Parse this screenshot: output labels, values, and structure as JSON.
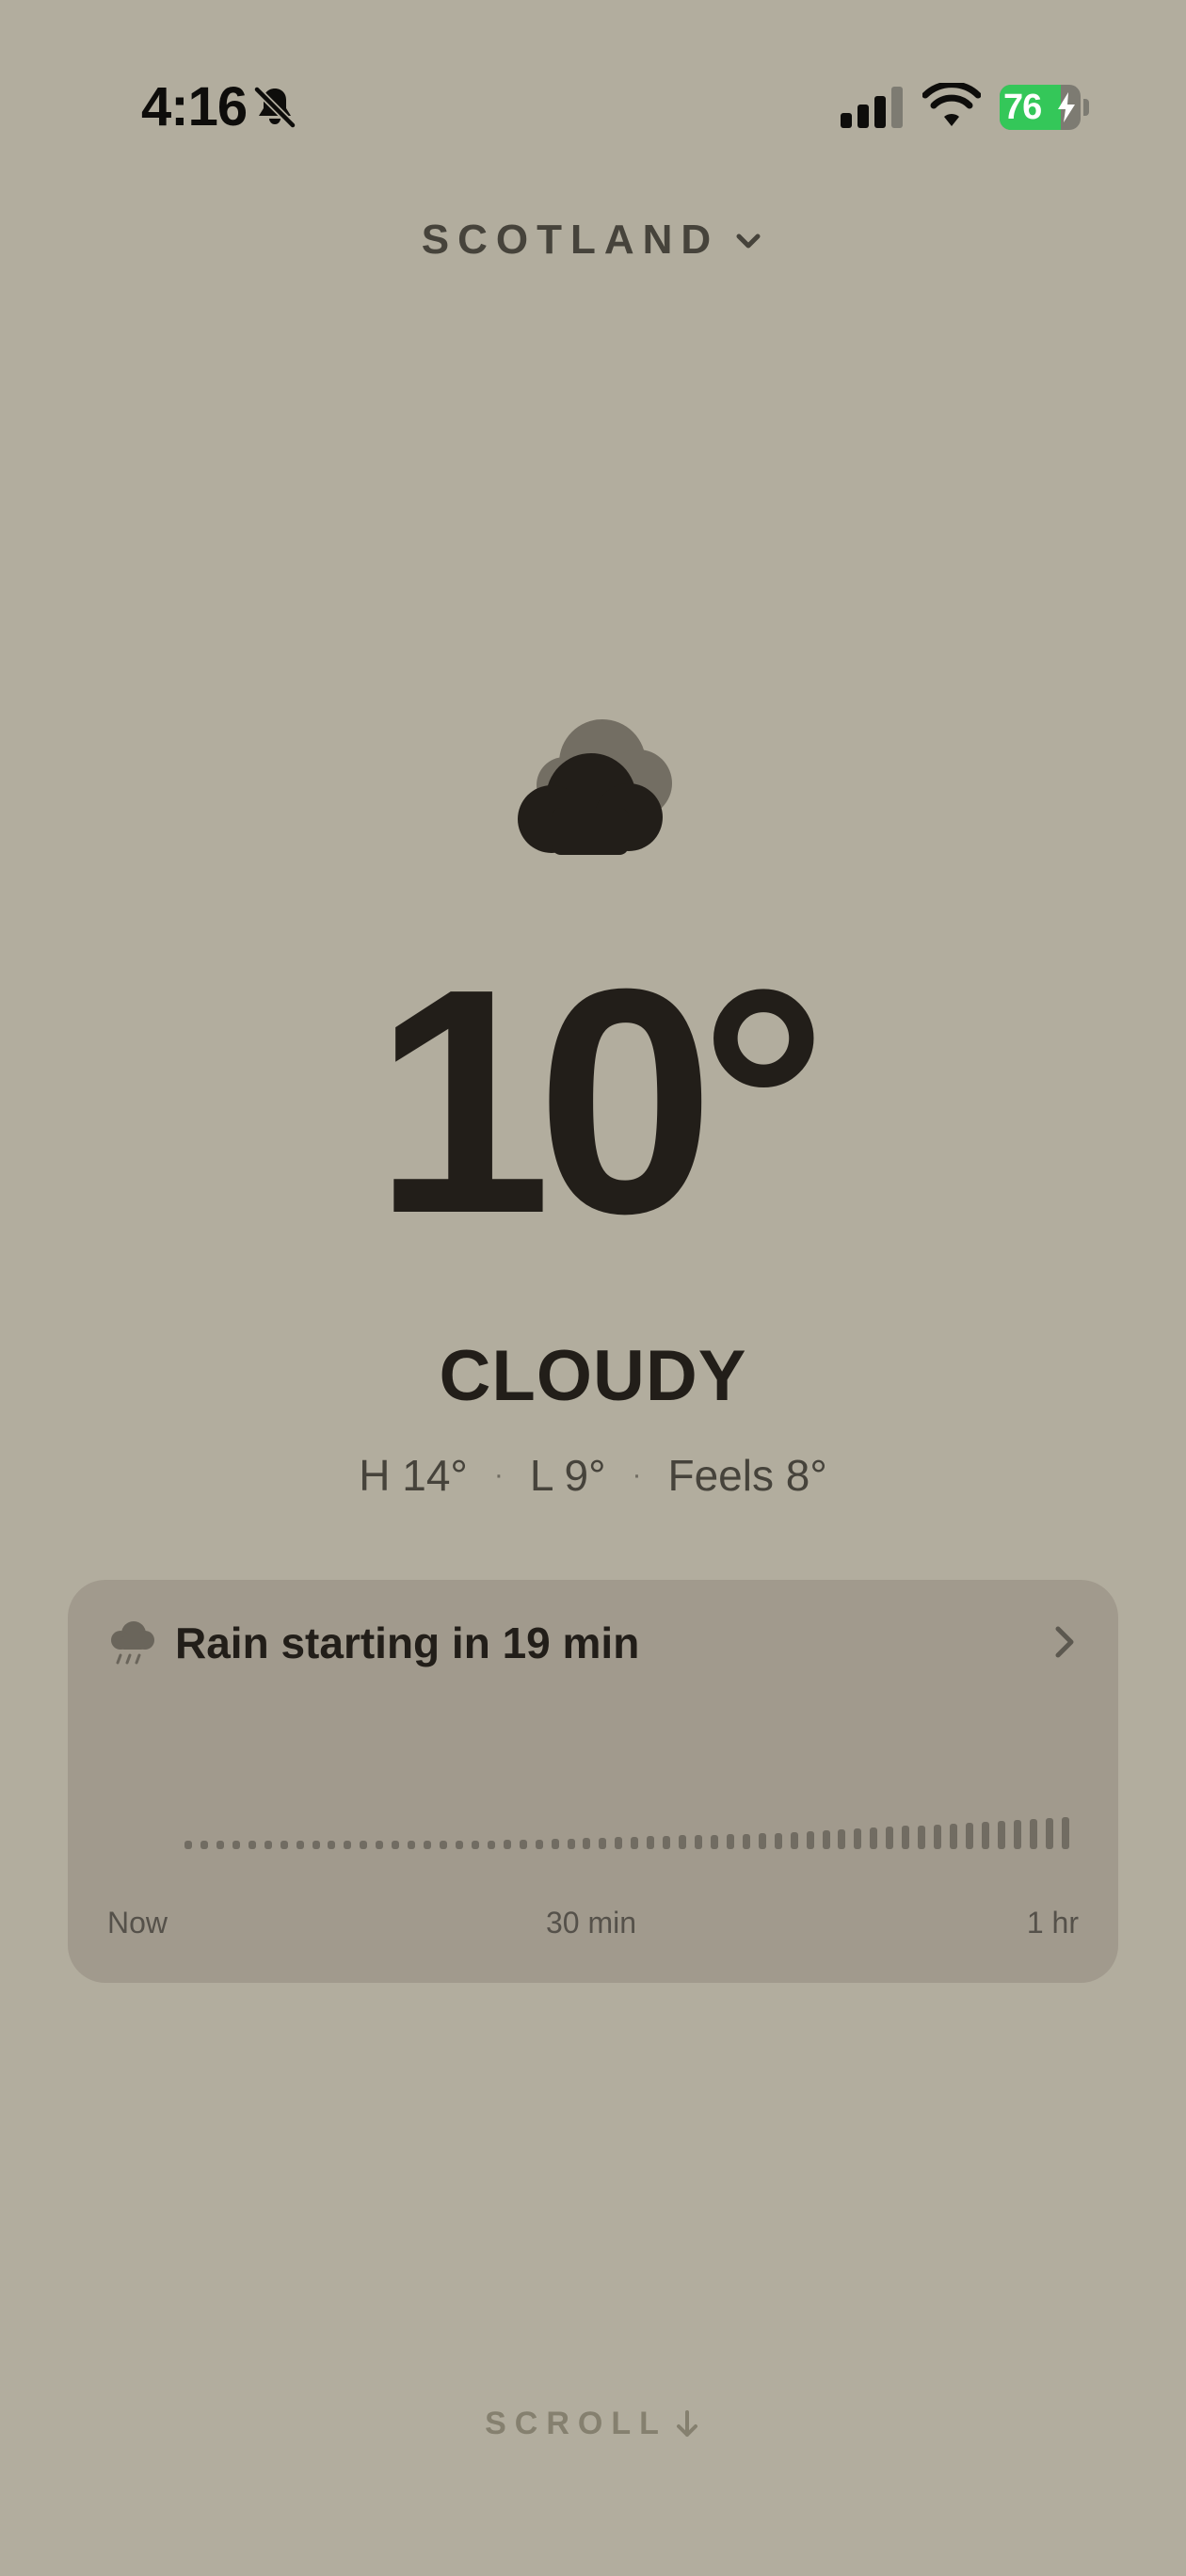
{
  "status_bar": {
    "time": "4:16",
    "battery_percent": "76",
    "battery_level": 0.76,
    "icons": [
      "bell-slash-icon",
      "cellular-signal-icon",
      "wifi-icon",
      "battery-charging-icon"
    ],
    "colors": {
      "battery_fill": "#34c759"
    }
  },
  "location": {
    "name": "SCOTLAND",
    "icon": "chevron-down-icon"
  },
  "weather": {
    "icon": "cloud-icon",
    "temperature": "10°",
    "condition": "CLOUDY",
    "high": "H 14°",
    "low": "L 9°",
    "feels": "Feels 8°",
    "separator": "·"
  },
  "rain_card": {
    "icon": "cloud-rain-icon",
    "title": "Rain starting in 19 min",
    "chevron": "chevron-right-icon",
    "intensity": [
      0.2,
      0.2,
      0.2,
      0.2,
      0.2,
      0.2,
      0.2,
      0.2,
      0.2,
      0.2,
      0.2,
      0.2,
      0.2,
      0.2,
      0.2,
      0.2,
      0.2,
      0.2,
      0.2,
      0.2,
      0.21,
      0.22,
      0.23,
      0.24,
      0.25,
      0.26,
      0.27,
      0.28,
      0.29,
      0.3,
      0.31,
      0.32,
      0.33,
      0.34,
      0.35,
      0.36,
      0.37,
      0.38,
      0.4,
      0.42,
      0.44,
      0.46,
      0.48,
      0.5,
      0.52,
      0.54,
      0.56,
      0.58,
      0.6,
      0.62,
      0.64,
      0.66,
      0.68,
      0.7,
      0.72,
      0.74
    ],
    "axis_labels": {
      "start": "Now",
      "mid": "30 min",
      "end": "1 hr"
    },
    "colors": {
      "card_bg": "#a19a8d",
      "bar": "#716c62"
    }
  },
  "scroll_hint": {
    "label": "SCROLL",
    "icon": "arrow-down-icon"
  },
  "colors": {
    "background": "#b2ad9e",
    "text": "#221e19"
  }
}
